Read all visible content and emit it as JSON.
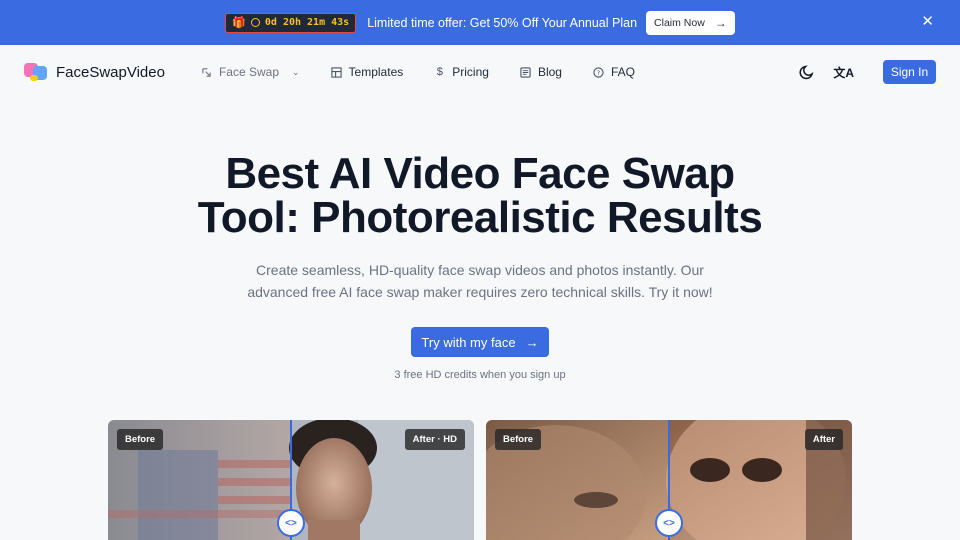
{
  "promo": {
    "timer": "0d 20h 21m 43s",
    "text": "Limited time offer: Get 50% Off Your Annual Plan",
    "claim_label": "Claim Now"
  },
  "nav": {
    "brand": "FaceSwapVideo",
    "items": [
      {
        "label": "Face Swap",
        "icon": "face-swap-icon"
      },
      {
        "label": "Templates",
        "icon": "grid-icon"
      },
      {
        "label": "Pricing",
        "icon": "dollar-icon"
      },
      {
        "label": "Blog",
        "icon": "newspaper-icon"
      },
      {
        "label": "FAQ",
        "icon": "help-circle-icon"
      }
    ],
    "signin_label": "Sign In"
  },
  "hero": {
    "title_line1": "Best AI Video Face Swap",
    "title_line2": "Tool: Photorealistic Results",
    "subtitle_line1": "Create seamless, HD-quality face swap videos and photos instantly. Our",
    "subtitle_line2": "advanced free AI face swap maker requires zero technical skills. Try it now!",
    "cta_label": "Try with my face",
    "cta_note": "3 free HD credits when you sign up"
  },
  "comparisons": [
    {
      "before_label": "Before",
      "after_label": "After · HD"
    },
    {
      "before_label": "Before",
      "after_label": "After"
    }
  ],
  "colors": {
    "accent": "#3b6be0",
    "background": "#f7f8fa",
    "heading": "#111827",
    "muted": "#6b7280"
  }
}
